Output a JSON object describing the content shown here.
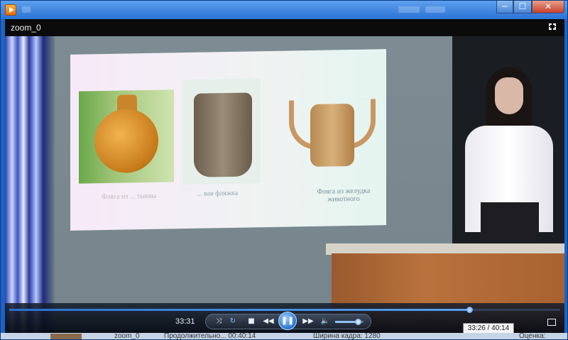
{
  "window": {
    "controls": {
      "minimize": "─",
      "maximize": "☐",
      "close": "✕"
    }
  },
  "video": {
    "title": "zoom_0",
    "slide": {
      "captions": [
        "Фляга из ... тыквы",
        "... вая фляжка",
        "Фляга из желудка животного"
      ]
    }
  },
  "player": {
    "elapsed": "33:31",
    "progress": 0.8345,
    "volume": 0.8,
    "tooltip": "33:26 / 40:14",
    "buttons": {
      "shuffle": "⤨",
      "repeat": "↻",
      "stop": "■",
      "previous": "◀◀",
      "play_pause": "❚❚",
      "next": "▶▶",
      "volume": "🔈"
    }
  },
  "background": {
    "items": [
      "zoom_0",
      "Продолжительно... 00:40:14",
      "Ширина кадра: 1280",
      "Оценка:"
    ]
  },
  "colors": {
    "accent": "#2a73d6",
    "seek": "#3d86e0"
  }
}
